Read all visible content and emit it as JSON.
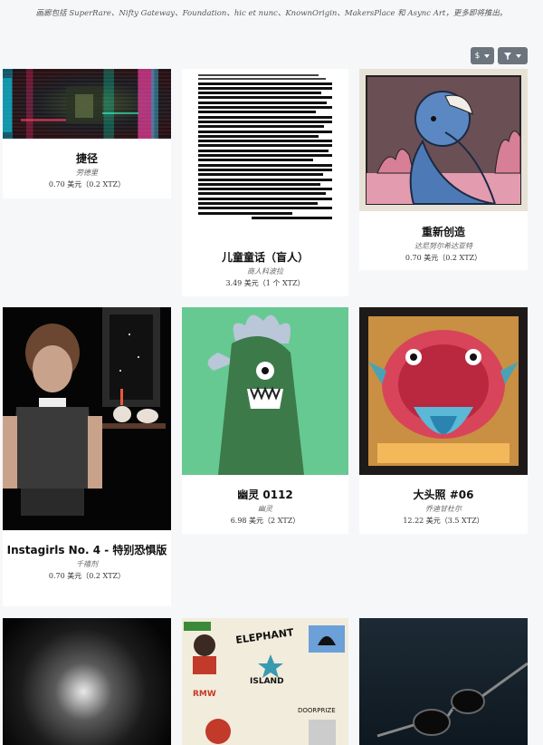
{
  "notice": "画廊包括 SuperRare、Nifty Gateway、Foundation、hic et nunc、KnownOrigin、MakersPlace 和 Async Art，更多即将推出。",
  "controls": {
    "currency_label": "$",
    "currency_icon": "caret-down-icon",
    "filter_icon": "filter-icon"
  },
  "cards": [
    {
      "title": "捷径",
      "artist": "劳德里",
      "price": "0.70 美元（0.2 XTZ）",
      "art": "glitch corridor"
    },
    {
      "title": "儿童童话（盲人）",
      "artist": "商人科波拉",
      "price": "3.49 美元（1 个 XTZ）",
      "art": "redacted text page"
    },
    {
      "title": "重新创造",
      "artist": "达尼努尔希达亚特",
      "price": "0.70 美元（0.2 XTZ）",
      "art": "blue figure"
    },
    {
      "title": "Instagirls No. 4 - 特别恐惧版",
      "artist": "千禧剂",
      "price": "0.70 美元（0.2 XTZ）",
      "art": "pixel girl"
    },
    {
      "title": "幽灵 0112",
      "artist": "幽灵",
      "price": "6.98 美元（2 XTZ）",
      "art": "green ghost"
    },
    {
      "title": "大头照 #06",
      "artist": "乔迪甘杜尔",
      "price": "12.22 美元（3.5 XTZ）",
      "art": "monster head"
    }
  ],
  "bottom_cards": [
    {
      "art": "grey tunnel"
    },
    {
      "art": "street collage",
      "text1": "ELEPHANT",
      "text2": "ISLAND",
      "text3": "DOORPRIZE",
      "text4": "RMW"
    },
    {
      "art": "sunglasses"
    }
  ],
  "colors": {
    "page_bg": "#f6f7f9",
    "button_bg": "#6c757d",
    "card_bg": "#ffffff"
  }
}
